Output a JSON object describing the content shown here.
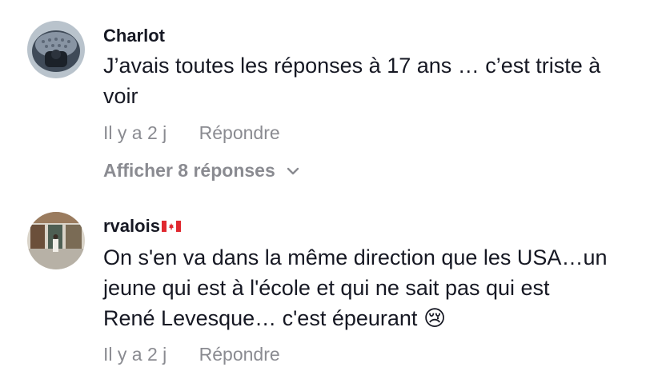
{
  "comments": [
    {
      "username": "Charlot",
      "text": "J’avais toutes les réponses à 17 ans … c’est triste à voir",
      "time": "Il y a 2 j",
      "reply_label": "Répondre",
      "view_replies_label": "Afficher 8 réponses"
    },
    {
      "username": "rvalois",
      "flag": "🇨🇦",
      "text_line1": "On s'en va dans la même direction que les USA…un",
      "text_line2": "jeune qui est à l'école et qui ne sait pas qui est",
      "text_line3": "René Levesque… c'est épeurant",
      "emoji": "😢",
      "time": "Il y a 2 j",
      "reply_label": "Répondre"
    }
  ],
  "icons": {
    "chevron": "chevron-down-icon",
    "flag": "canada-flag-icon",
    "emoji": "crying-face-emoji"
  }
}
